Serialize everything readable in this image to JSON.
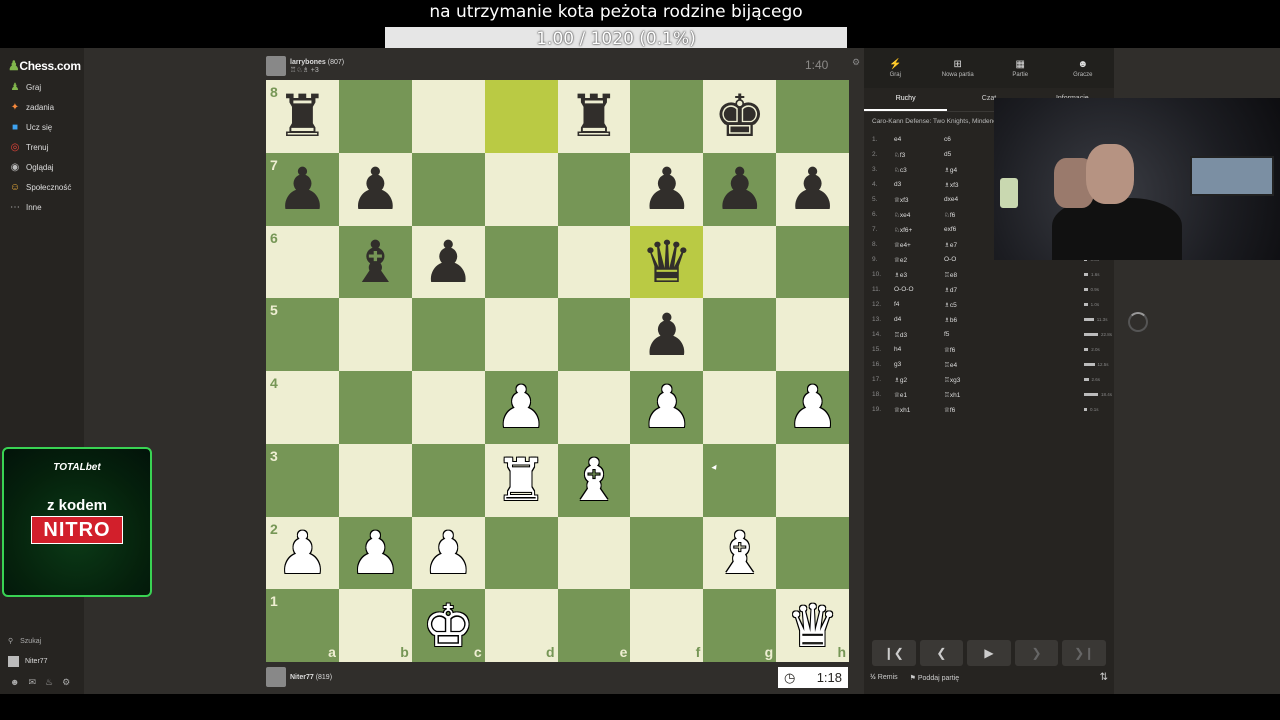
{
  "overlay": {
    "caption": "na utrzymanie kota peżota rodzine bijącego",
    "goal": "1.00 / 1020 (0.1%)"
  },
  "sidebar": {
    "logo": "Chess.com",
    "items": [
      {
        "icon": "play-icon",
        "glyph": "♟",
        "color": "#81b64c",
        "label": "Graj"
      },
      {
        "icon": "puzzle-icon",
        "glyph": "✦",
        "color": "#f7893c",
        "label": "zadania"
      },
      {
        "icon": "learn-icon",
        "glyph": "■",
        "color": "#3ea3f1",
        "label": "Ucz się"
      },
      {
        "icon": "train-icon",
        "glyph": "◎",
        "color": "#e9453a",
        "label": "Trenuj"
      },
      {
        "icon": "watch-icon",
        "glyph": "◉",
        "color": "#bbbbbb",
        "label": "Oglądaj"
      },
      {
        "icon": "community-icon",
        "glyph": "☺",
        "color": "#f1b13c",
        "label": "Społeczność"
      },
      {
        "icon": "more-icon",
        "glyph": "⋯",
        "color": "#bbbbbb",
        "label": "Inne"
      }
    ],
    "search_label": "Szukaj",
    "username": "Niter77"
  },
  "top_player": {
    "name": "larrybones",
    "rating": "(807)",
    "extra": "+3",
    "clock": "1:40"
  },
  "bottom_player": {
    "name": "Niter77",
    "rating": "(819)",
    "clock": "1:18"
  },
  "board": {
    "highlights": [
      "d8",
      "f6"
    ],
    "ranks": [
      "8",
      "7",
      "6",
      "5",
      "4",
      "3",
      "2",
      "1"
    ],
    "files": [
      "a",
      "b",
      "c",
      "d",
      "e",
      "f",
      "g",
      "h"
    ],
    "pieces": {
      "a8": "bR",
      "e8": "bR",
      "g8": "bK",
      "a7": "bP",
      "b7": "bP",
      "f7": "bP",
      "g7": "bP",
      "h7": "bP",
      "b6": "bB",
      "c6": "bP",
      "f6": "bQ",
      "f5": "bP",
      "d4": "wP",
      "f4": "wP",
      "h4": "wP",
      "d3": "wR",
      "e3": "wB",
      "a2": "wP",
      "b2": "wP",
      "c2": "wP",
      "g2": "wB",
      "c1": "wK",
      "h1": "wQ"
    }
  },
  "panel": {
    "tabs": [
      {
        "icon": "play-icon",
        "glyph": "⚡",
        "label": "Graj"
      },
      {
        "icon": "new-game-icon",
        "glyph": "⊞",
        "label": "Nowa partia"
      },
      {
        "icon": "games-icon",
        "glyph": "▦",
        "label": "Partie"
      },
      {
        "icon": "players-icon",
        "glyph": "☻",
        "label": "Gracze"
      }
    ],
    "subtabs": [
      "Ruchy",
      "Czat",
      "Informacje"
    ],
    "opening": "Caro-Kann Defense: Two Knights, Mindeno",
    "moves": [
      {
        "no": "1.",
        "w": "e4",
        "b": "c6"
      },
      {
        "no": "2.",
        "w": "♘f3",
        "b": "d5"
      },
      {
        "no": "3.",
        "w": "♘c3",
        "b": "♗g4"
      },
      {
        "no": "4.",
        "w": "d3",
        "b": "♗xf3"
      },
      {
        "no": "5.",
        "w": "♕xf3",
        "b": "dxe4"
      },
      {
        "no": "6.",
        "w": "♘xe4",
        "b": "♘f6"
      },
      {
        "no": "7.",
        "w": "♘xf6+",
        "b": "exf6"
      },
      {
        "no": "8.",
        "w": "♕e4+",
        "b": "♗e7"
      },
      {
        "no": "9.",
        "w": "♕e2",
        "b": "O-O"
      },
      {
        "no": "10.",
        "w": "♗e3",
        "b": "♖e8"
      },
      {
        "no": "11.",
        "w": "O-O-O",
        "b": "♗d7"
      },
      {
        "no": "12.",
        "w": "f4",
        "b": "♗c5"
      },
      {
        "no": "13.",
        "w": "d4",
        "b": "♗b6"
      },
      {
        "no": "14.",
        "w": "♖d3",
        "b": "f5"
      },
      {
        "no": "15.",
        "w": "h4",
        "b": "♕f6"
      },
      {
        "no": "16.",
        "w": "g3",
        "b": "♖e4"
      },
      {
        "no": "17.",
        "w": "♗g2",
        "b": "♖xg3"
      },
      {
        "no": "18.",
        "w": "♕e1",
        "b": "♖xh1"
      },
      {
        "no": "19.",
        "w": "♕xh1",
        "b": "♕f6"
      }
    ],
    "times": [
      "",
      "",
      "",
      "",
      "",
      "",
      "",
      "1.2s",
      "0.8s",
      "1.6s",
      "0.9s",
      "1.0s",
      "11.3s",
      "22.8s",
      "2.0s",
      "12.5s",
      "2.6s",
      "18.4s",
      "0.1s"
    ],
    "draw_label": "Remis",
    "resign_label": "Poddaj partię",
    "draw_symbol": "½"
  },
  "promo": {
    "brand": "TOTALbet",
    "line1": "z kodem",
    "line2": "NITRO"
  }
}
